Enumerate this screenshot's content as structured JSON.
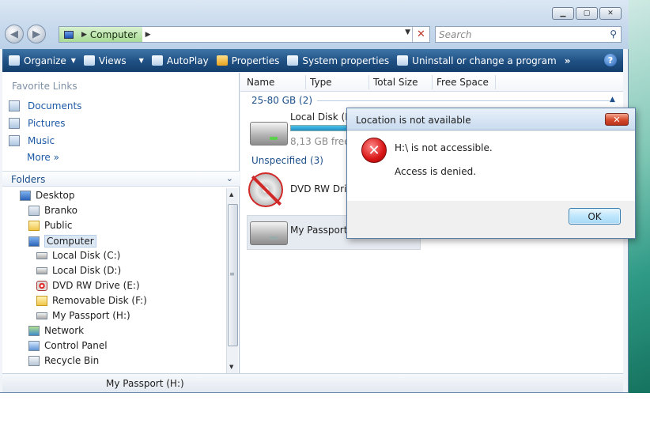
{
  "window": {
    "address": {
      "crumb": "Computer"
    },
    "search": {
      "placeholder": "Search"
    }
  },
  "toolbar": {
    "organize": "Organize",
    "views": "Views",
    "autoplay": "AutoPlay",
    "properties": "Properties",
    "system_properties": "System properties",
    "uninstall": "Uninstall or change a program",
    "more": "»",
    "help": "?"
  },
  "left_pane": {
    "favorite_links_title": "Favorite Links",
    "favorites": [
      "Documents",
      "Pictures",
      "Music"
    ],
    "more": "More »",
    "folders_title": "Folders",
    "tree": [
      "Desktop",
      "Branko",
      "Public",
      "Computer",
      "Local Disk (C:)",
      "Local Disk (D:)",
      "DVD RW Drive (E:)",
      "Removable Disk (F:)",
      "My Passport (H:)",
      "Network",
      "Control Panel",
      "Recycle Bin"
    ]
  },
  "right_pane": {
    "columns": [
      "Name",
      "Type",
      "Total Size",
      "Free Space"
    ],
    "group1": "25-80 GB (2)",
    "group2": "Unspecified (3)",
    "items": {
      "local_disk_d": {
        "name": "Local Disk (D:)",
        "free": "8,13 GB free of",
        "usage_fraction": 0.85
      },
      "dvd": {
        "name": "DVD RW Drive (E:)"
      },
      "passport": {
        "name": "My Passport (H:)"
      }
    }
  },
  "status": {
    "text": "My Passport (H:)"
  },
  "dialog": {
    "title": "Location is not available",
    "message": "H:\\ is not accessible.",
    "detail": "Access is denied.",
    "ok": "OK"
  }
}
